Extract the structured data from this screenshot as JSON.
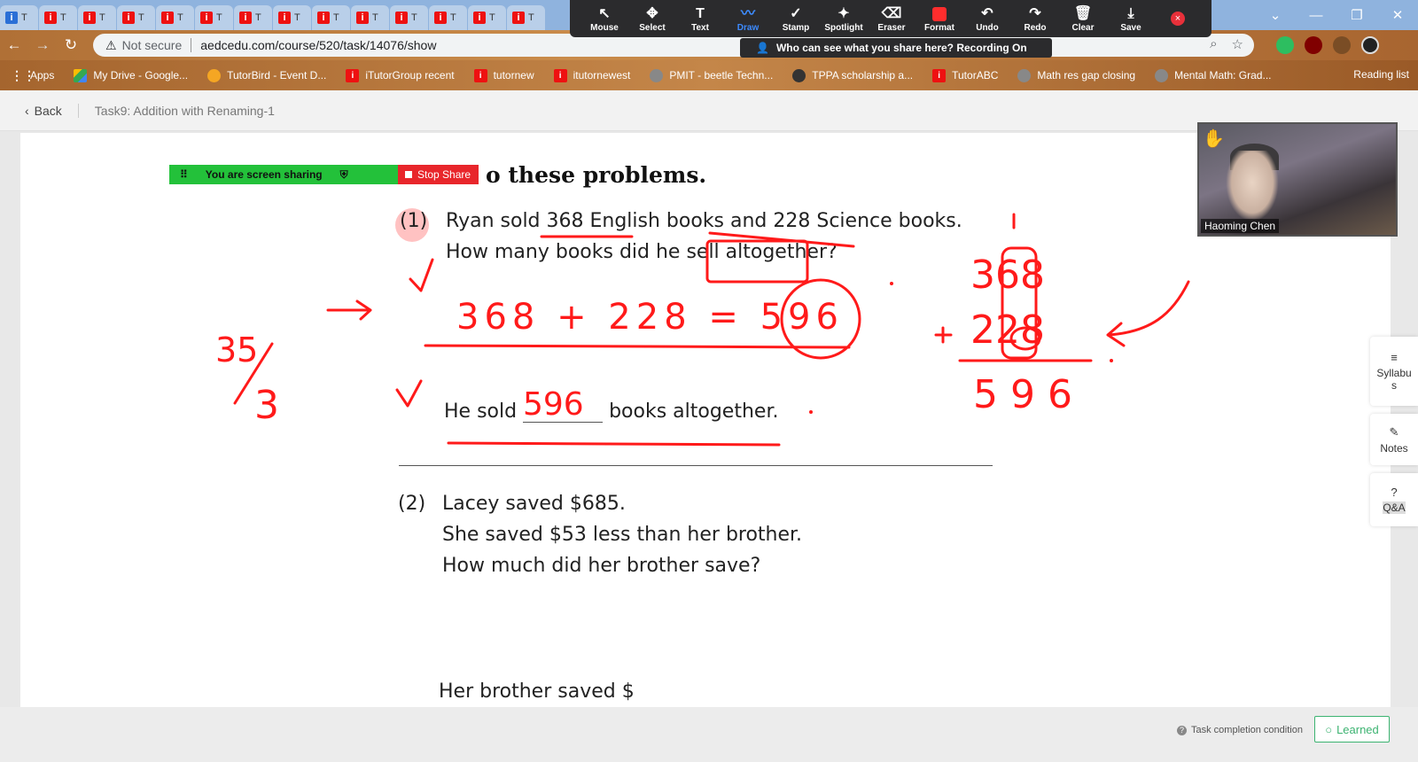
{
  "browser": {
    "tab_count": 14,
    "tab_letter": "T",
    "tab_favicon_letter": "i",
    "window_controls": [
      "⌄",
      "—",
      "❐",
      "✕"
    ],
    "address": {
      "security_label": "Not secure",
      "url": "aedcedu.com/course/520/task/14076/show"
    },
    "bookmarks": [
      {
        "label": "Apps",
        "icon": "apps-grid-icon"
      },
      {
        "label": "My Drive - Google...",
        "icon": "google-drive-icon"
      },
      {
        "label": "TutorBird - Event D...",
        "icon": "tutorbird-icon"
      },
      {
        "label": "iTutorGroup recent",
        "icon": "itutor-icon"
      },
      {
        "label": "tutornew",
        "icon": "itutor-icon"
      },
      {
        "label": "itutornewest",
        "icon": "itutor-icon"
      },
      {
        "label": "PMIT - beetle Techn...",
        "icon": "globe-icon"
      },
      {
        "label": "TPPA scholarship a...",
        "icon": "tppa-icon"
      },
      {
        "label": "TutorABC",
        "icon": "itutor-icon"
      },
      {
        "label": "Math res gap closing",
        "icon": "globe-icon"
      },
      {
        "label": "Mental Math: Grad...",
        "icon": "globe-icon"
      }
    ],
    "reading_list": "Reading list"
  },
  "zoom_toolbar": {
    "tools": [
      {
        "label": "Mouse",
        "icon": "↖"
      },
      {
        "label": "Select",
        "icon": "✥"
      },
      {
        "label": "Text",
        "icon": "T"
      },
      {
        "label": "Draw",
        "icon": "〰"
      },
      {
        "label": "Stamp",
        "icon": "✓"
      },
      {
        "label": "Spotlight",
        "icon": "✦"
      },
      {
        "label": "Eraser",
        "icon": "⌫"
      },
      {
        "label": "Format",
        "icon": ""
      },
      {
        "label": "Undo",
        "icon": "↶"
      },
      {
        "label": "Redo",
        "icon": "↷"
      },
      {
        "label": "Clear",
        "icon": "🗑"
      },
      {
        "label": "Save",
        "icon": "⤓"
      }
    ],
    "active_tool": "Draw",
    "format_color": "#ff2d2d",
    "banner": "Who can see what you share here? Recording On"
  },
  "page": {
    "back_label": "Back",
    "breadcrumb": "Task9:  Addition with Renaming-1"
  },
  "worksheet": {
    "heading": "o these problems.",
    "q1": {
      "number": "(1)",
      "line1": "Ryan sold 368 English books and 228 Science books.",
      "line2": "How many books did he sell altogether?",
      "answer_pre": "He sold",
      "answer_post": "books altogether."
    },
    "q2": {
      "number": "(2)",
      "line1": "Lacey saved $685.",
      "line2": "She saved $53 less than her brother.",
      "line3": "How much did her brother save?",
      "answer_partial": "Her brother saved $"
    }
  },
  "ink": {
    "equation": "368 + 228 = 596",
    "answer_fill": "596",
    "carry": "1",
    "top_number": "368",
    "plus": "+",
    "bottom_number": "228",
    "sum": "596",
    "arrow": "→",
    "fraction_top": "35",
    "fraction_bottom": "3",
    "color": "#ff1a1a"
  },
  "share_bar": {
    "status": "You are screen sharing",
    "stop_label": "Stop Share"
  },
  "video": {
    "participant": "Haoming Chen"
  },
  "side_panel": {
    "syllabus_label": "Syllabus",
    "notes_label": "Notes",
    "qa_label": "Q&A"
  },
  "footer": {
    "task_condition": "Task completion condition",
    "learned_label": "Learned"
  }
}
